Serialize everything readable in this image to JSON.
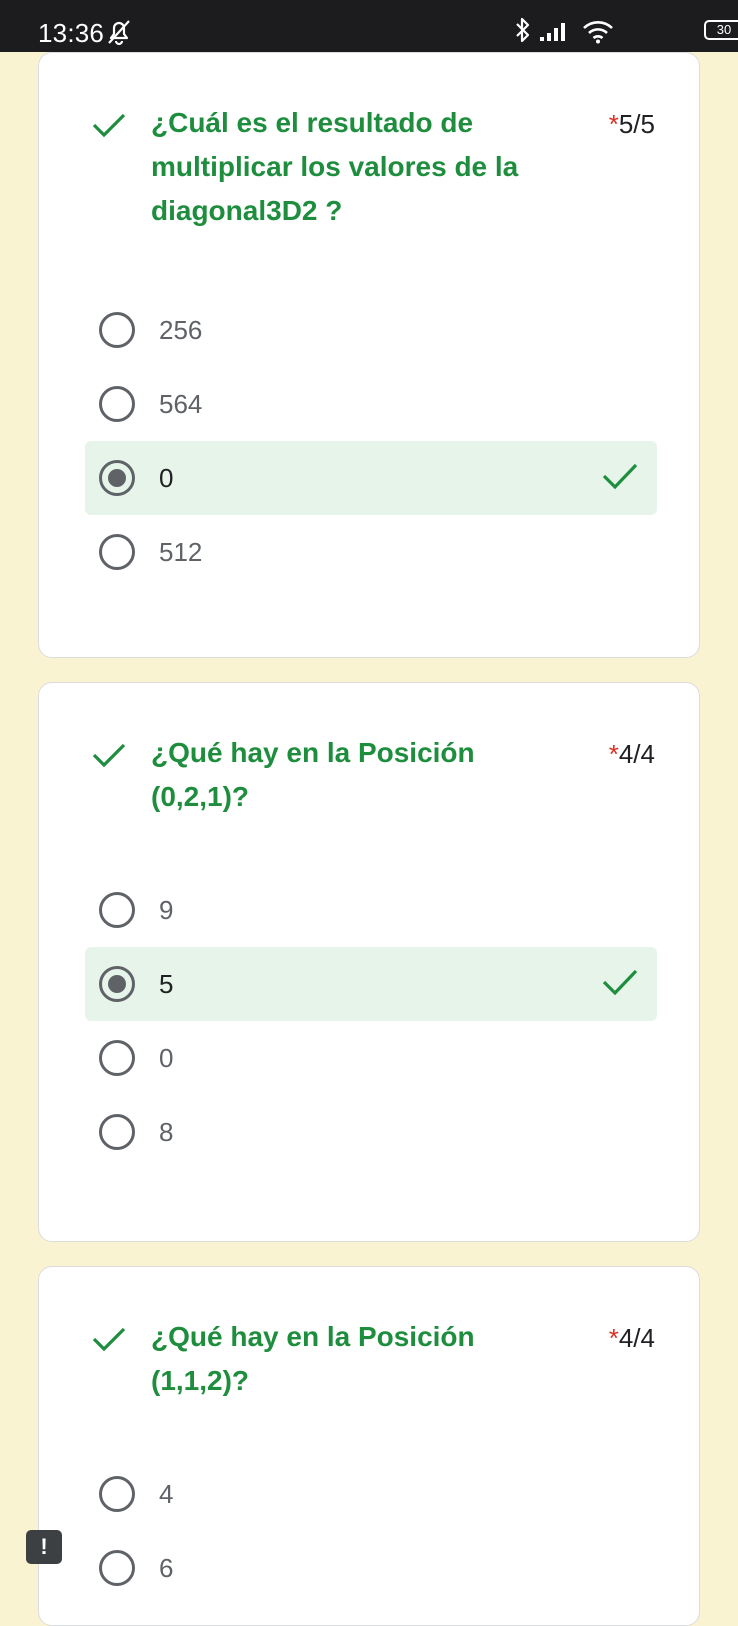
{
  "status_bar": {
    "time": "13:36",
    "battery": "30"
  },
  "questions": [
    {
      "title": "¿Cuál es el resultado de multiplicar los valores de la diagonal3D2 ?",
      "required_mark": "*",
      "score": "5/5",
      "options": [
        "256",
        "564",
        "0",
        "512"
      ],
      "selected_index": 2
    },
    {
      "title": "¿Qué hay en la  Posición (0,2,1)?",
      "required_mark": "*",
      "score": "4/4",
      "options": [
        "9",
        "5",
        "0",
        "8"
      ],
      "selected_index": 1
    },
    {
      "title": "¿Qué hay en la  Posición (1,1,2)?",
      "required_mark": "*",
      "score": "4/4",
      "options": [
        "4",
        "6"
      ],
      "selected_index": null
    }
  ],
  "report_button": {
    "label": "!"
  },
  "colors": {
    "correct": "#1e8e3e",
    "required": "#d93025",
    "selected_bg": "#e6f4ea",
    "page_bg": "#faf3d2"
  }
}
